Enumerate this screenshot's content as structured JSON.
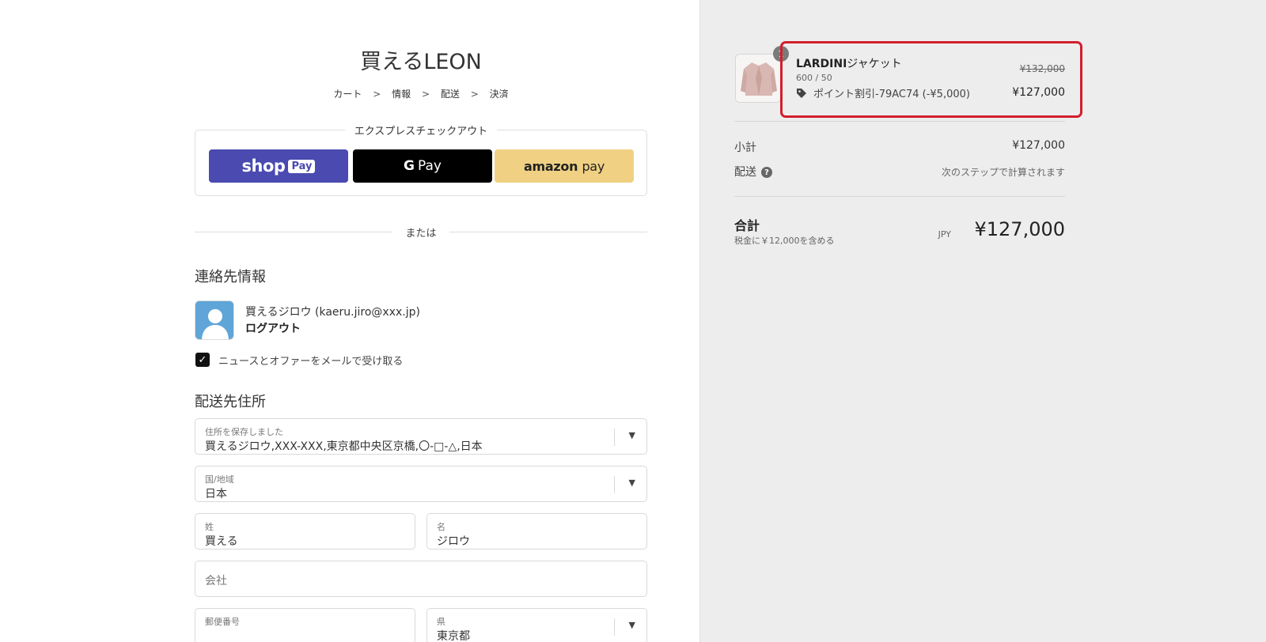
{
  "store": {
    "title": "買えるLEON"
  },
  "breadcrumb": {
    "cart": "カート",
    "info": "情報",
    "shipping": "配送",
    "payment": "決済",
    "sep": ">"
  },
  "express": {
    "title": "エクスプレスチェックアウト",
    "shop_brand": "shop",
    "shop_pill": "Pay",
    "gpay_g": "G",
    "gpay_text": "Pay",
    "amazon_a": "amazon",
    "amazon_b": "pay"
  },
  "or_text": "または",
  "contact": {
    "heading": "連絡先情報",
    "user": "買えるジロウ (kaeru.jiro@xxx.jp)",
    "logout": "ログアウト",
    "newsletter_label": "ニュースとオファーをメールで受け取る",
    "check_mark": "✓"
  },
  "shipping": {
    "heading": "配送先住所",
    "saved_label": "住所を保存しました",
    "saved_value": "買えるジロウ,XXX-XXX,東京都中央区京橋,〇-□-△,日本",
    "country_label": "国/地域",
    "country_value": "日本",
    "last_label": "姓",
    "last_value": "買える",
    "first_label": "名",
    "first_value": "ジロウ",
    "company_placeholder": "会社",
    "postal_label": "郵便番号",
    "pref_label": "県",
    "pref_value": "東京都",
    "chevron": "▼"
  },
  "order": {
    "product_name_latin": "LARDINI",
    "product_name_jp": "ジャケット",
    "variant": "600 / 50",
    "discount": "ポイント割引-79AC74 (-¥5,000)",
    "price_old": "¥132,000",
    "price_new": "¥127,000",
    "quantity": "1",
    "subtotal_label": "小計",
    "subtotal_value": "¥127,000",
    "shipping_label": "配送",
    "shipping_value": "次のステップで計算されます",
    "help": "?",
    "total_label": "合計",
    "tax_note": "税金に￥12,000を含める",
    "currency": "JPY",
    "total_value": "¥127,000"
  },
  "colors": {
    "highlight": "#d31e2c",
    "shop_pay": "#4a4ab0",
    "amazon": "#f0d184",
    "side_bg": "#ededed"
  }
}
